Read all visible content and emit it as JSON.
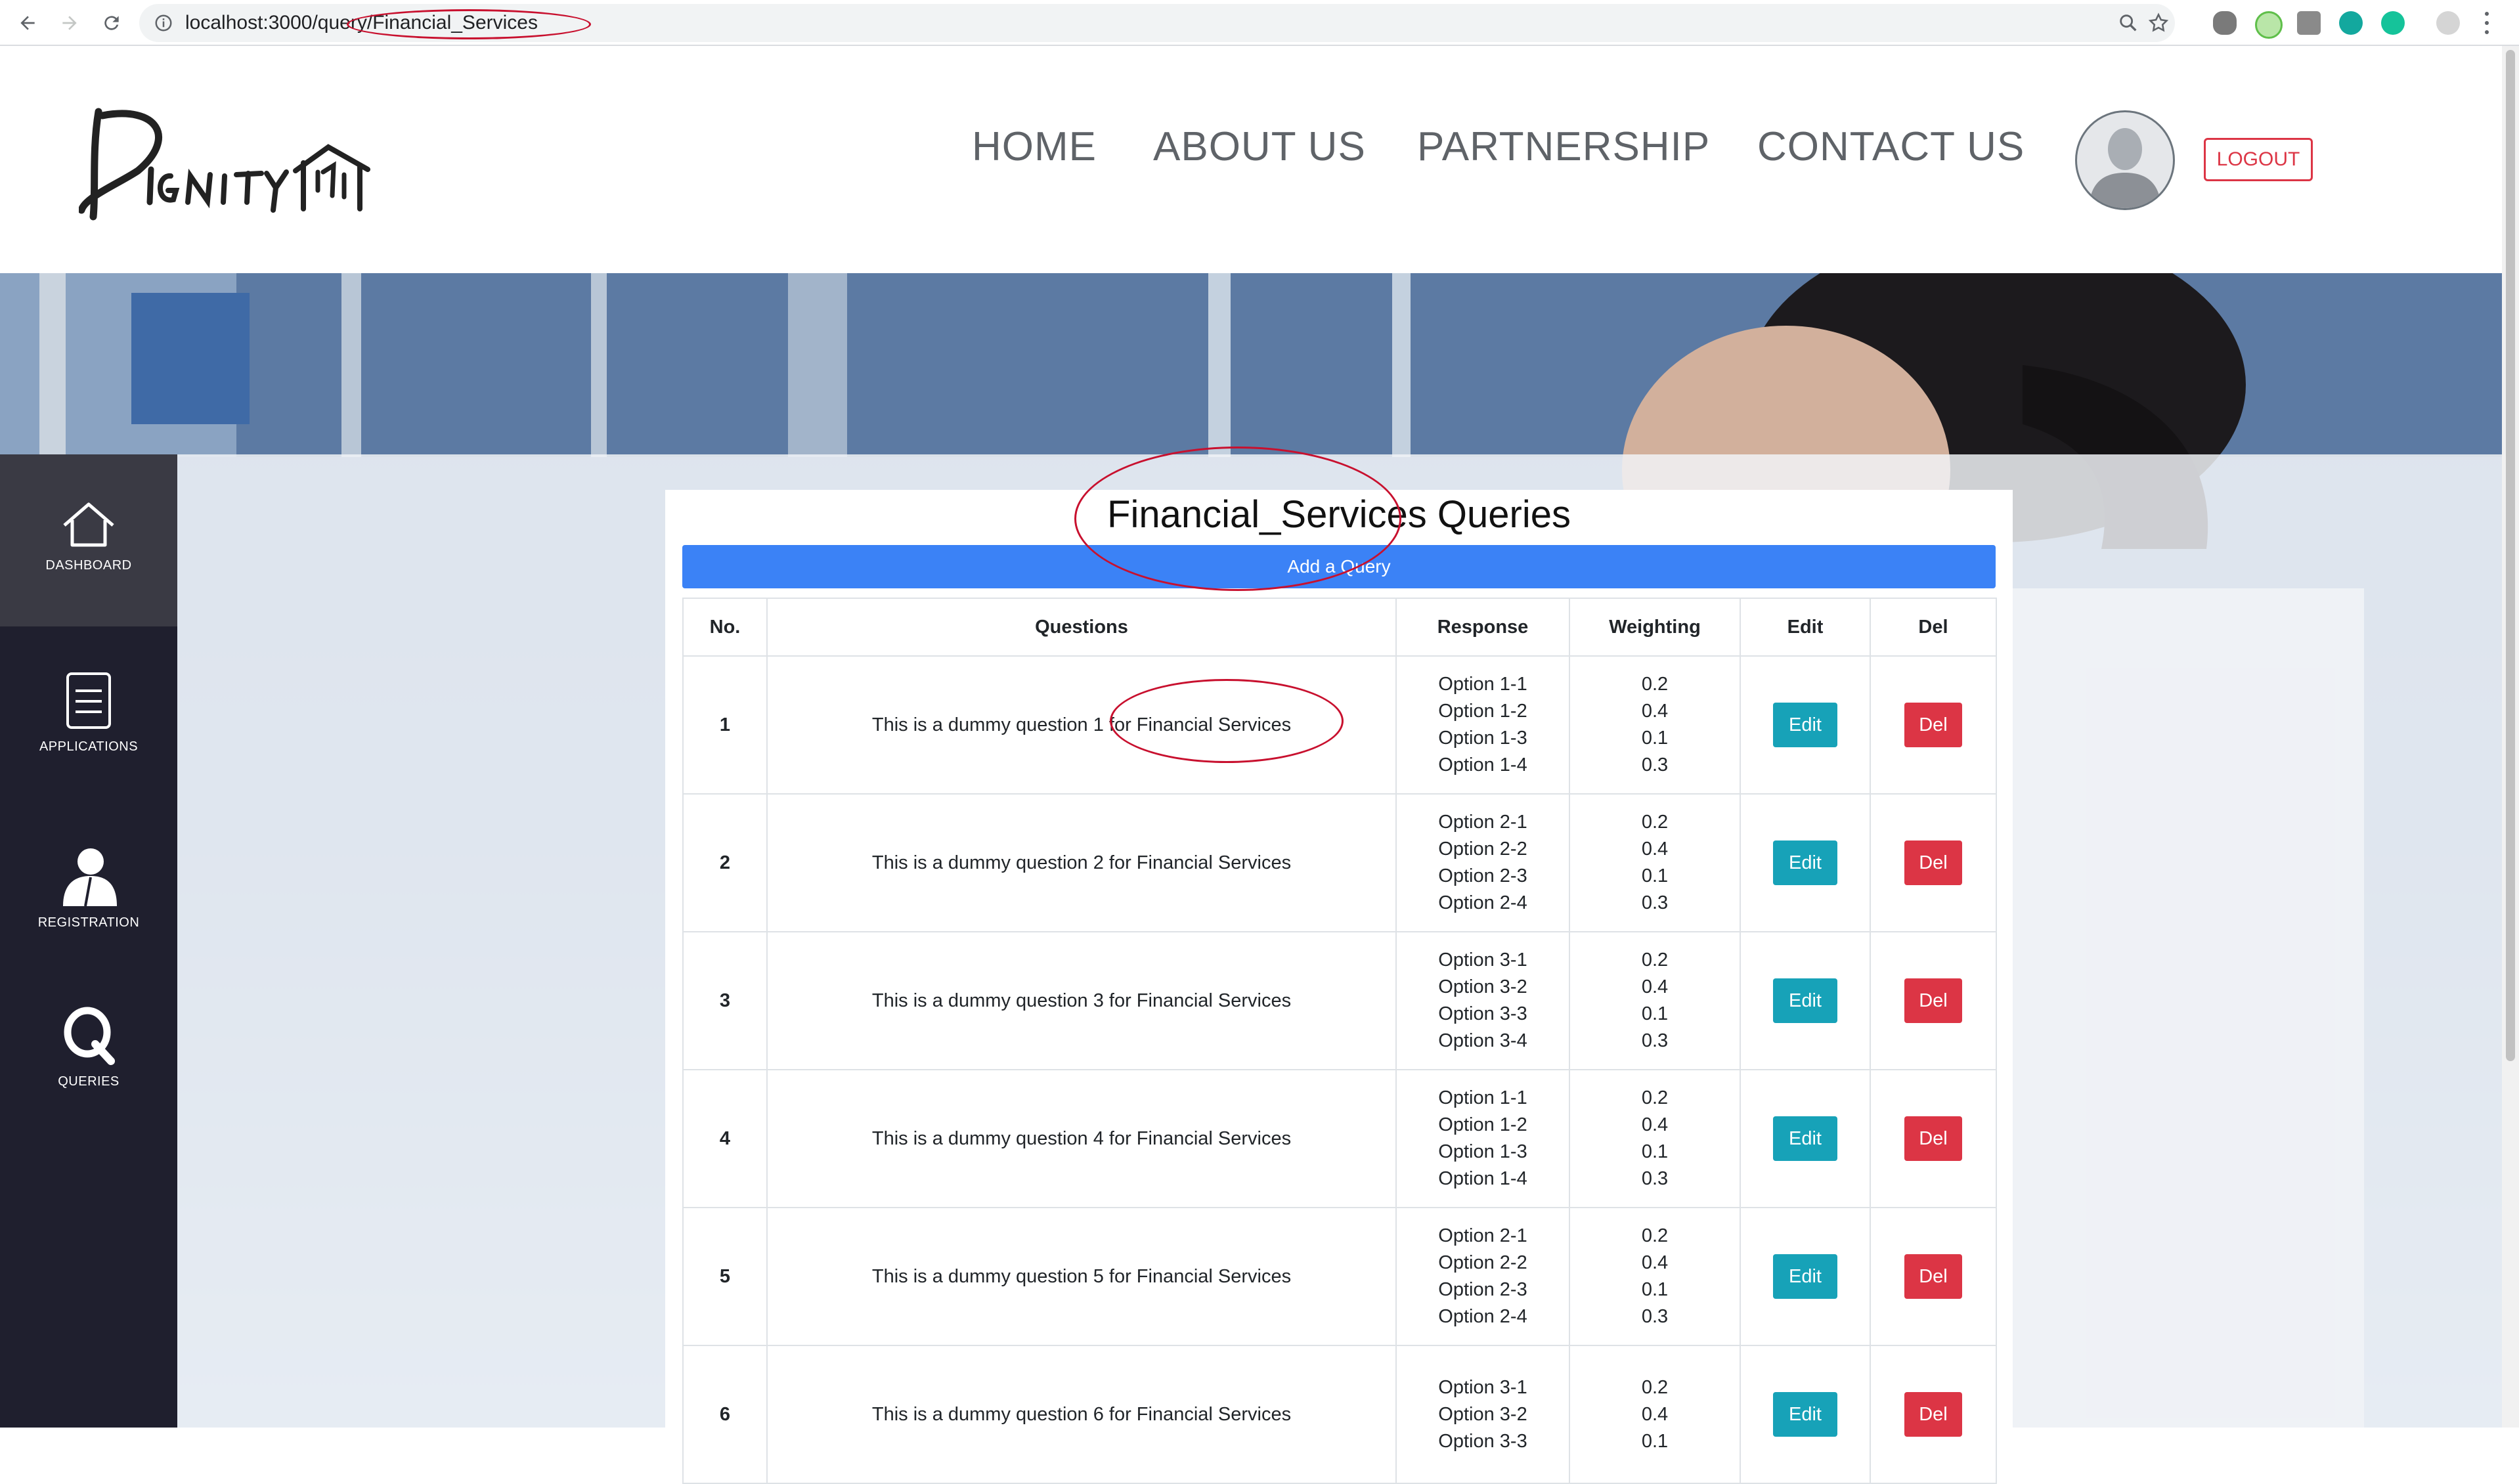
{
  "browser": {
    "url": "localhost:3000/query/Financial_Services"
  },
  "header": {
    "logo_text": "Dignity",
    "nav": [
      "HOME",
      "ABOUT US",
      "PARTNERSHIP",
      "CONTACT US"
    ],
    "logout_label": "LOGOUT"
  },
  "sidebar": {
    "items": [
      {
        "label": "DASHBOARD",
        "icon": "home-icon"
      },
      {
        "label": "APPLICATIONS",
        "icon": "document-icon"
      },
      {
        "label": "REGISTRATION",
        "icon": "user-icon"
      },
      {
        "label": "QUERIES",
        "icon": "q-icon"
      }
    ]
  },
  "main": {
    "title": "Financial_Services Queries",
    "add_button": "Add a Query",
    "columns": [
      "No.",
      "Questions",
      "Response",
      "Weighting",
      "Edit",
      "Del"
    ],
    "rows": [
      {
        "no": "1",
        "question": "This is a dummy question 1 for Financial Services",
        "options": [
          "Option 1-1",
          "Option 1-2",
          "Option 1-3",
          "Option 1-4"
        ],
        "weights": [
          "0.2",
          "0.4",
          "0.1",
          "0.3"
        ],
        "edit": "Edit",
        "del": "Del"
      },
      {
        "no": "2",
        "question": "This is a dummy question 2 for Financial Services",
        "options": [
          "Option 2-1",
          "Option 2-2",
          "Option 2-3",
          "Option 2-4"
        ],
        "weights": [
          "0.2",
          "0.4",
          "0.1",
          "0.3"
        ],
        "edit": "Edit",
        "del": "Del"
      },
      {
        "no": "3",
        "question": "This is a dummy question 3 for Financial Services",
        "options": [
          "Option 3-1",
          "Option 3-2",
          "Option 3-3",
          "Option 3-4"
        ],
        "weights": [
          "0.2",
          "0.4",
          "0.1",
          "0.3"
        ],
        "edit": "Edit",
        "del": "Del"
      },
      {
        "no": "4",
        "question": "This is a dummy question 4 for Financial Services",
        "options": [
          "Option 1-1",
          "Option 1-2",
          "Option 1-3",
          "Option 1-4"
        ],
        "weights": [
          "0.2",
          "0.4",
          "0.1",
          "0.3"
        ],
        "edit": "Edit",
        "del": "Del"
      },
      {
        "no": "5",
        "question": "This is a dummy question 5 for Financial Services",
        "options": [
          "Option 2-1",
          "Option 2-2",
          "Option 2-3",
          "Option 2-4"
        ],
        "weights": [
          "0.2",
          "0.4",
          "0.1",
          "0.3"
        ],
        "edit": "Edit",
        "del": "Del"
      },
      {
        "no": "6",
        "question": "This is a dummy question 6 for Financial Services",
        "options": [
          "Option 3-1",
          "Option 3-2",
          "Option 3-3"
        ],
        "weights": [
          "0.2",
          "0.4",
          "0.1"
        ],
        "edit": "Edit",
        "del": "Del"
      }
    ]
  },
  "colors": {
    "primary": "#3b82f6",
    "edit": "#17a2b8",
    "danger": "#dc3545",
    "sidebar": "#1f1f2e",
    "annotation": "#c8102e"
  }
}
